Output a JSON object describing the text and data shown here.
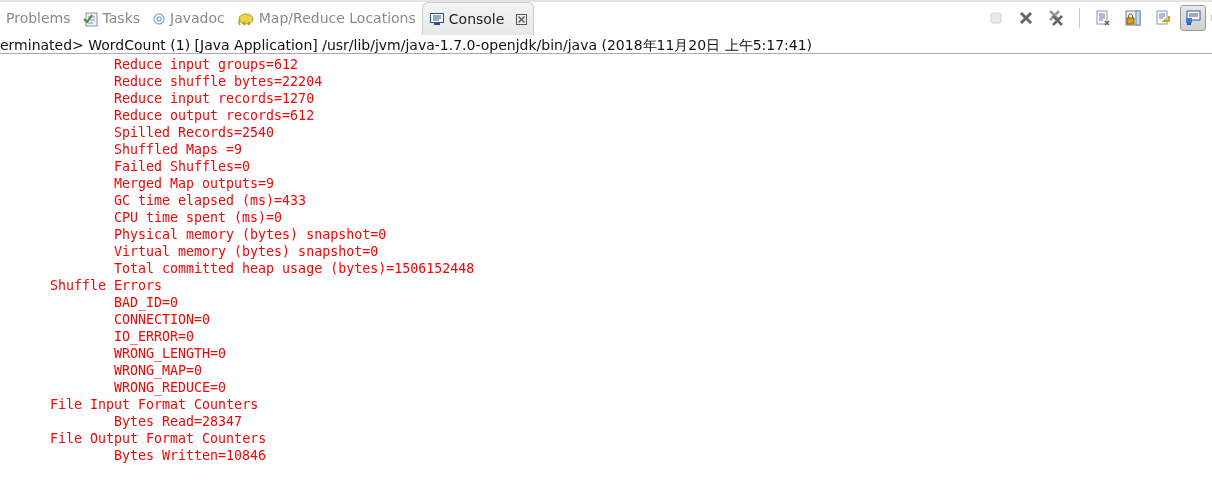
{
  "tabs": [
    {
      "label": "Problems",
      "kind": "none",
      "selected": false
    },
    {
      "label": "Tasks",
      "kind": "tasks",
      "selected": false
    },
    {
      "label": "Javadoc",
      "kind": "at",
      "selected": false
    },
    {
      "label": "Map/Reduce Locations",
      "kind": "elephant",
      "selected": false
    },
    {
      "label": "Console",
      "kind": "console",
      "selected": true
    }
  ],
  "toolbar": [
    {
      "kind": "stop",
      "disabled": true,
      "selected": false
    },
    {
      "kind": "remove",
      "disabled": false,
      "selected": false
    },
    {
      "kind": "remove_all",
      "disabled": false,
      "selected": false
    },
    {
      "kind": "separator"
    },
    {
      "kind": "clear",
      "disabled": false,
      "selected": false
    },
    {
      "kind": "scroll_lock",
      "disabled": false,
      "selected": false
    },
    {
      "kind": "word_wrap",
      "disabled": false,
      "selected": false
    },
    {
      "kind": "display",
      "disabled": false,
      "selected": true
    },
    {
      "kind": "partial",
      "disabled": false,
      "selected": false
    }
  ],
  "console_label": "erminated> WordCount (1) [Java Application] /usr/lib/jvm/java-1.7.0-openjdk/bin/java (2018年11月20日 上午5:17:41)",
  "output": [
    {
      "children": [
        {
          "text": "Reduce input groups=612"
        },
        {
          "text": "Reduce shuffle bytes=22204"
        },
        {
          "text": "Reduce input records=1270"
        },
        {
          "text": "Reduce output records=612"
        },
        {
          "text": "Spilled Records=2540"
        },
        {
          "text": "Shuffled Maps =9"
        },
        {
          "text": "Failed Shuffles=0"
        },
        {
          "text": "Merged Map outputs=9"
        },
        {
          "text": "GC time elapsed (ms)=433"
        },
        {
          "text": "CPU time spent (ms)=0"
        },
        {
          "text": "Physical memory (bytes) snapshot=0"
        },
        {
          "text": "Virtual memory (bytes) snapshot=0"
        },
        {
          "text": "Total committed heap usage (bytes)=1506152448"
        }
      ]
    },
    {
      "text": "Shuffle Errors",
      "children": [
        {
          "text": "BAD_ID=0"
        },
        {
          "text": "CONNECTION=0"
        },
        {
          "text": "IO_ERROR=0"
        },
        {
          "text": "WRONG_LENGTH=0"
        },
        {
          "text": "WRONG_MAP=0"
        },
        {
          "text": "WRONG_REDUCE=0"
        }
      ]
    },
    {
      "text": "File Input Format Counters",
      "children": [
        {
          "text": "Bytes Read=28347"
        }
      ]
    },
    {
      "text": "File Output Format Counters",
      "children": [
        {
          "text": "Bytes Written=10846"
        }
      ]
    }
  ]
}
